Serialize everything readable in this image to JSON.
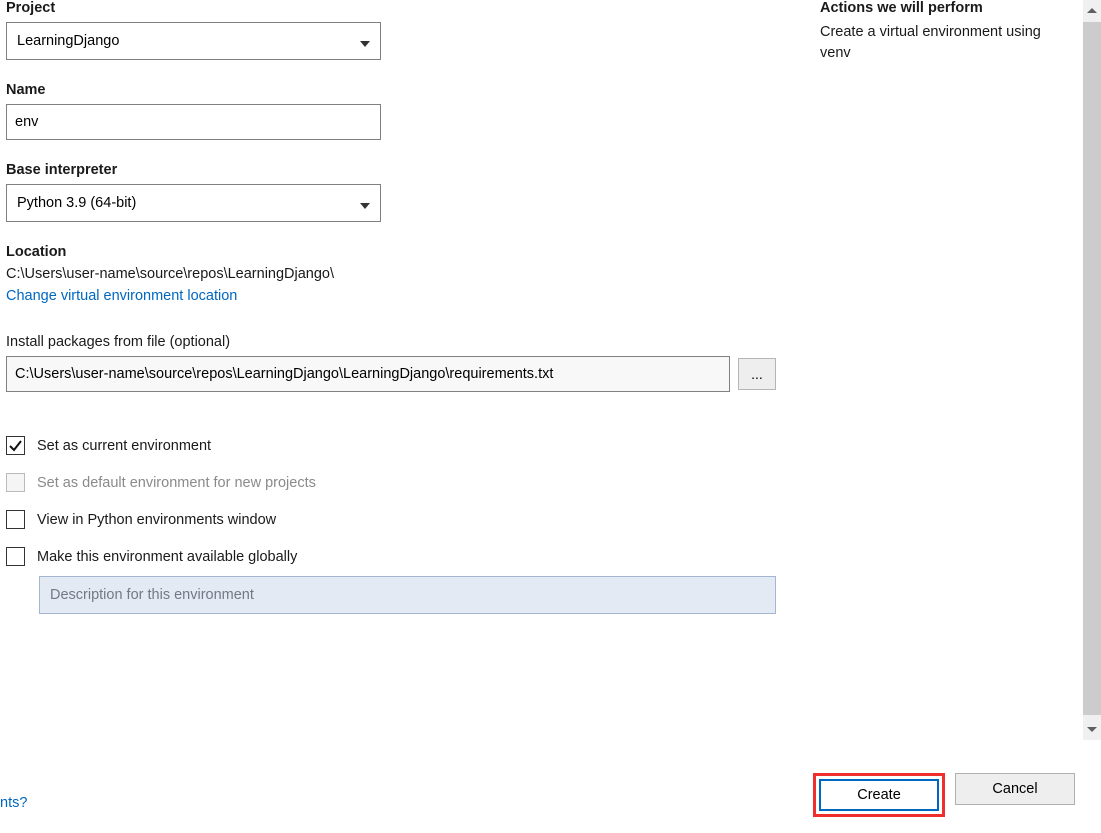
{
  "form": {
    "project": {
      "label": "Project",
      "selected": "LearningDjango",
      "options": [
        "LearningDjango"
      ]
    },
    "name": {
      "label": "Name",
      "value": "env"
    },
    "baseInterp": {
      "label": "Base interpreter",
      "selected": "Python 3.9 (64-bit)",
      "options": [
        "Python 3.9 (64-bit)"
      ]
    },
    "location": {
      "label": "Location",
      "path": "C:\\Users\\user-name\\source\\repos\\LearningDjango\\",
      "changeLink": "Change virtual environment location"
    },
    "packages": {
      "label": "Install packages from file (optional)",
      "value": "C:\\Users\\user-name\\source\\repos\\LearningDjango\\LearningDjango\\requirements.txt",
      "browse": "..."
    },
    "checks": {
      "setCurrent": {
        "label": "Set as current environment",
        "checked": true
      },
      "setDefault": {
        "label": "Set as default environment for new projects",
        "disabled": true
      },
      "viewPython": {
        "label": "View in Python environments window"
      },
      "makeGlobal": {
        "label": "Make this environment available globally"
      },
      "descPlaceholder": "Description for this environment"
    }
  },
  "sidebar": {
    "title": "Actions we will perform",
    "text": "Create a virtual environment using venv"
  },
  "buttons": {
    "create": "Create",
    "cancel": "Cancel"
  },
  "helpLink": "nts?"
}
